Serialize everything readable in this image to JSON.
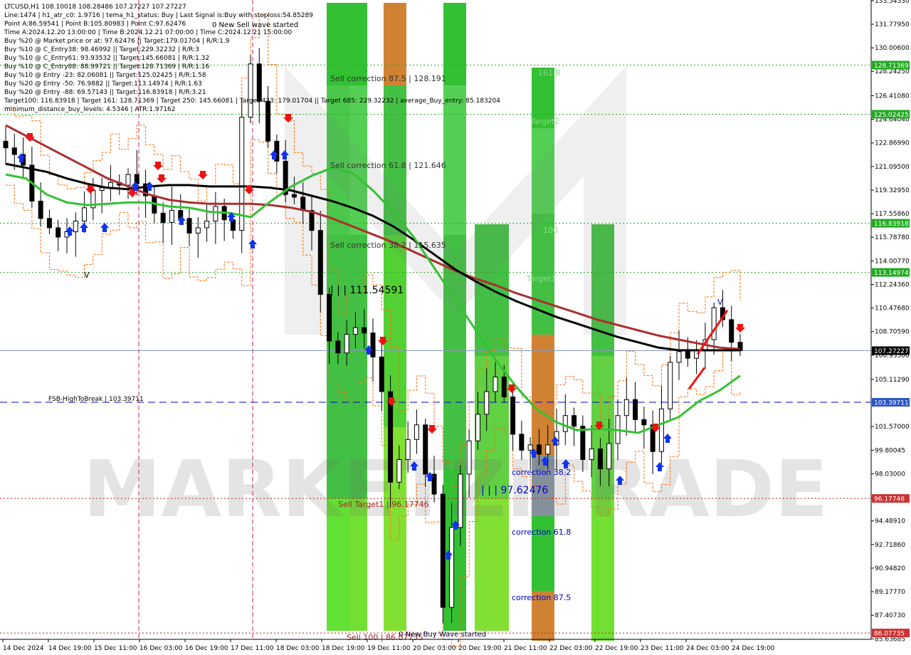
{
  "chart_data": {
    "type": "candlestick",
    "symbol": "LTCUSD,H1",
    "ohlc_header": "108.10018 108.28486 107.27227 107.27227",
    "watermark": "MARKETZITRADE",
    "colors": {
      "up": "#000000",
      "down": "#000000",
      "ma_long": "#000000",
      "ma_mid": "#aa2f2f",
      "ma_fast": "#33c233",
      "band": "#ff6a00",
      "level_line": "#22aa22",
      "fsb_line": "#0000cc",
      "sell_target_line": "#aa2222",
      "price_label_green": "#22aa22",
      "price_label_red": "#cc3333",
      "price_label_blue": "#2a56c6",
      "price_label_current": "#000000",
      "zone_green": "#22bb22",
      "zone_orange": "#cc7722",
      "zone_gray": "#7a8894"
    },
    "ylim": [
      85.6,
      133.6
    ],
    "y_ticks": [
      "133.54530",
      "131.77950",
      "130.00600",
      "128.24250",
      "126.41080",
      "124.64040",
      "122.86990",
      "121.09500",
      "119.32950",
      "117.55860",
      "115.78780",
      "114.00770",
      "112.24360",
      "110.47680",
      "108.70590",
      "106.93500",
      "105.11290",
      "101.57000",
      "99.80045",
      "98.03000",
      "96.17746",
      "94.48910",
      "92.71860",
      "90.94820",
      "89.17770",
      "87.40730",
      "85.63685"
    ],
    "x_labels": [
      "14 Dec 2024",
      "14 Dec 19:00",
      "15 Dec 11:00",
      "16 Dec 03:00",
      "16 Dec 19:00",
      "17 Dec 11:00",
      "18 Dec 03:00",
      "18 Dec 19:00",
      "19 Dec 11:00",
      "20 Dec 03:00",
      "20 Dec 19:00",
      "21 Dec 11:00",
      "22 Dec 03:00",
      "22 Dec 19:00",
      "23 Dec 11:00",
      "24 Dec 03:00",
      "24 Dec 19:00"
    ],
    "price_labels": [
      {
        "value": 128.71369,
        "text": "128.71369",
        "color": "green"
      },
      {
        "value": 125.02425,
        "text": "125.02425",
        "color": "green"
      },
      {
        "value": 116.83918,
        "text": "116.83918",
        "color": "green"
      },
      {
        "value": 113.14974,
        "text": "113.14974",
        "color": "green"
      },
      {
        "value": 107.27227,
        "text": "107.27227",
        "color": "current"
      },
      {
        "value": 103.39711,
        "text": "103.39711",
        "color": "blue"
      },
      {
        "value": 96.17746,
        "text": "96.17746",
        "color": "red"
      },
      {
        "value": 86.07735,
        "text": "86.07735",
        "color": "red"
      }
    ],
    "info_lines": [
      "LTCUSD,H1  108.10018 108.28486 107.27227 107.27227",
      "Line:1474 | h1_atr_c0: 1.9716 | tema_h1_status: Buy | Last Signal is:Buy with stoploss:54.85289",
      "Point A:86.59541 | Point B:105.80983 | Point C:97.62476",
      "Time A:2024.12.20 13:00:00 | Time B:2024.12.21 07:00:00 | Time C:2024.12.21 15:00:00",
      "Buy %20 @ Market price or at: 97.62476 || Target:179.01704 | R/R:1.9",
      "Buy %10 @ C_Entry38: 98.46992 || Target:229.32232 | R/R:3",
      "Buy %10 @ C_Entry61: 93.93532 || Target:145.66081 | R/R:1.32",
      "Buy %10 @ C_Entry88: 88.99721 || Target:128.71369 | R/R:1.16",
      "Buy %10 @ Entry -23: 82.06081 || Target:125.02425 | R/R:1.58",
      "Buy %20 @ Entry -50: 76.9882 || Target:113.14974 | R/R:1.63",
      "Buy %20 @ Entry -88: 69.57143 || Target:116.83918 | R/R:3.21",
      "Target100: 116.83918 | Target 161: 128.71369 | Target 250: 145.66081 | Target 423: 179.01704 || Target 685: 229.32232 | average_Buy_entry: 85.183204",
      "minimum_distance_buy_levels: 4.5346 | ATR:1.97162"
    ],
    "new_sell_wave": "0 New Sell wave started",
    "new_buy_wave": "0 New Buy Wave started",
    "annotations": [
      {
        "text": "Sell correction 87.5 | 128.191",
        "color": "#333"
      },
      {
        "text": "Sell correction 61.8 | 121.646",
        "color": "#333"
      },
      {
        "text": "Sell correction 38.2 | 115.635",
        "color": "#333"
      },
      {
        "text": "| | | 111.54591",
        "color": "#000"
      },
      {
        "text": "161.8",
        "color": "#8dd88d"
      },
      {
        "text": "Target2",
        "color": "#8dd88d"
      },
      {
        "text": "100",
        "color": "#8dd88d"
      },
      {
        "text": "Target1",
        "color": "#8dd88d"
      },
      {
        "text": "FSB-HighToBreak | 103.39711",
        "color": "#000"
      },
      {
        "text": "correction 38.2",
        "color": "#0000cc"
      },
      {
        "text": "| | | 97.62476",
        "color": "#0000cc"
      },
      {
        "text": "correction 61.8",
        "color": "#0000cc"
      },
      {
        "text": "correction 87.5",
        "color": "#0000cc"
      },
      {
        "text": "Sell Target1 | 96.17746",
        "color": "#aa2222"
      },
      {
        "text": "Sell 100 | 86.07735",
        "color": "#aa2222"
      },
      {
        "text": "V",
        "color": "#000"
      },
      {
        "text": "V",
        "color": "#0000cc"
      }
    ],
    "series": [
      {
        "name": "close",
        "values": [
          122.5,
          122.0,
          121.2,
          118.5,
          117.2,
          116.5,
          115.8,
          116.2,
          117.0,
          118.0,
          119.3,
          119.5,
          119.9,
          119.7,
          120.5,
          119.8,
          118.9,
          117.6,
          116.9,
          117.8,
          117.2,
          116.1,
          116.5,
          117.0,
          118.1,
          117.1,
          116.3,
          124.8,
          128.8,
          126.0,
          123.0,
          121.5,
          119.0,
          118.8,
          117.8,
          116.3,
          111.5,
          108.0,
          107.1,
          108.5,
          109.0,
          108.6,
          106.8,
          104.2,
          97.4,
          99.1,
          100.6,
          101.7,
          98.0,
          96.5,
          88.0,
          94.0,
          98.0,
          100.5,
          102.5,
          104.2,
          105.3,
          103.8,
          101.0,
          99.8,
          100.2,
          99.5,
          100.2,
          101.2,
          102.4,
          101.6,
          99.1,
          99.9,
          98.4,
          100.3,
          102.4,
          103.6,
          102.1,
          101.7,
          99.7,
          102.9,
          106.4,
          107.2,
          106.7,
          107.3,
          108.1,
          110.5,
          109.6,
          107.9,
          107.27
        ]
      }
    ],
    "ma_long": [
      121.3,
      121.0,
      120.7,
      120.2,
      119.8,
      119.5,
      119.4,
      119.6,
      119.7,
      119.7,
      119.6,
      119.6,
      119.6,
      119.5,
      119.3,
      118.9,
      118.5,
      118.0,
      117.4,
      116.6,
      115.6,
      114.5,
      113.4,
      112.5,
      111.7,
      111.0,
      110.4,
      109.8,
      109.3,
      108.8,
      108.3,
      107.9,
      107.5,
      107.3,
      107.3,
      107.3,
      107.3
    ],
    "ma_mid": [
      124.2,
      123.4,
      122.6,
      121.8,
      121.0,
      120.2,
      119.6,
      119.0,
      118.6,
      118.4,
      118.3,
      118.3,
      118.3,
      118.2,
      118.0,
      117.7,
      117.2,
      116.6,
      116.0,
      115.4,
      114.7,
      114.0,
      113.3,
      112.7,
      112.2,
      111.6,
      111.1,
      110.6,
      110.1,
      109.6,
      109.2,
      108.8,
      108.4,
      108.1,
      107.8,
      107.5,
      107.4
    ],
    "ma_fast": [
      120.5,
      120.2,
      119.0,
      118.4,
      118.2,
      118.3,
      118.4,
      118.4,
      118.1,
      118.0,
      117.7,
      117.6,
      117.3,
      118.5,
      119.6,
      120.4,
      121.0,
      120.6,
      119.3,
      117.7,
      115.8,
      113.5,
      111.2,
      108.9,
      106.6,
      104.6,
      102.9,
      101.9,
      101.3,
      101.4,
      101.3,
      101.1,
      101.7,
      102.3,
      103.5,
      104.3,
      105.4
    ]
  }
}
